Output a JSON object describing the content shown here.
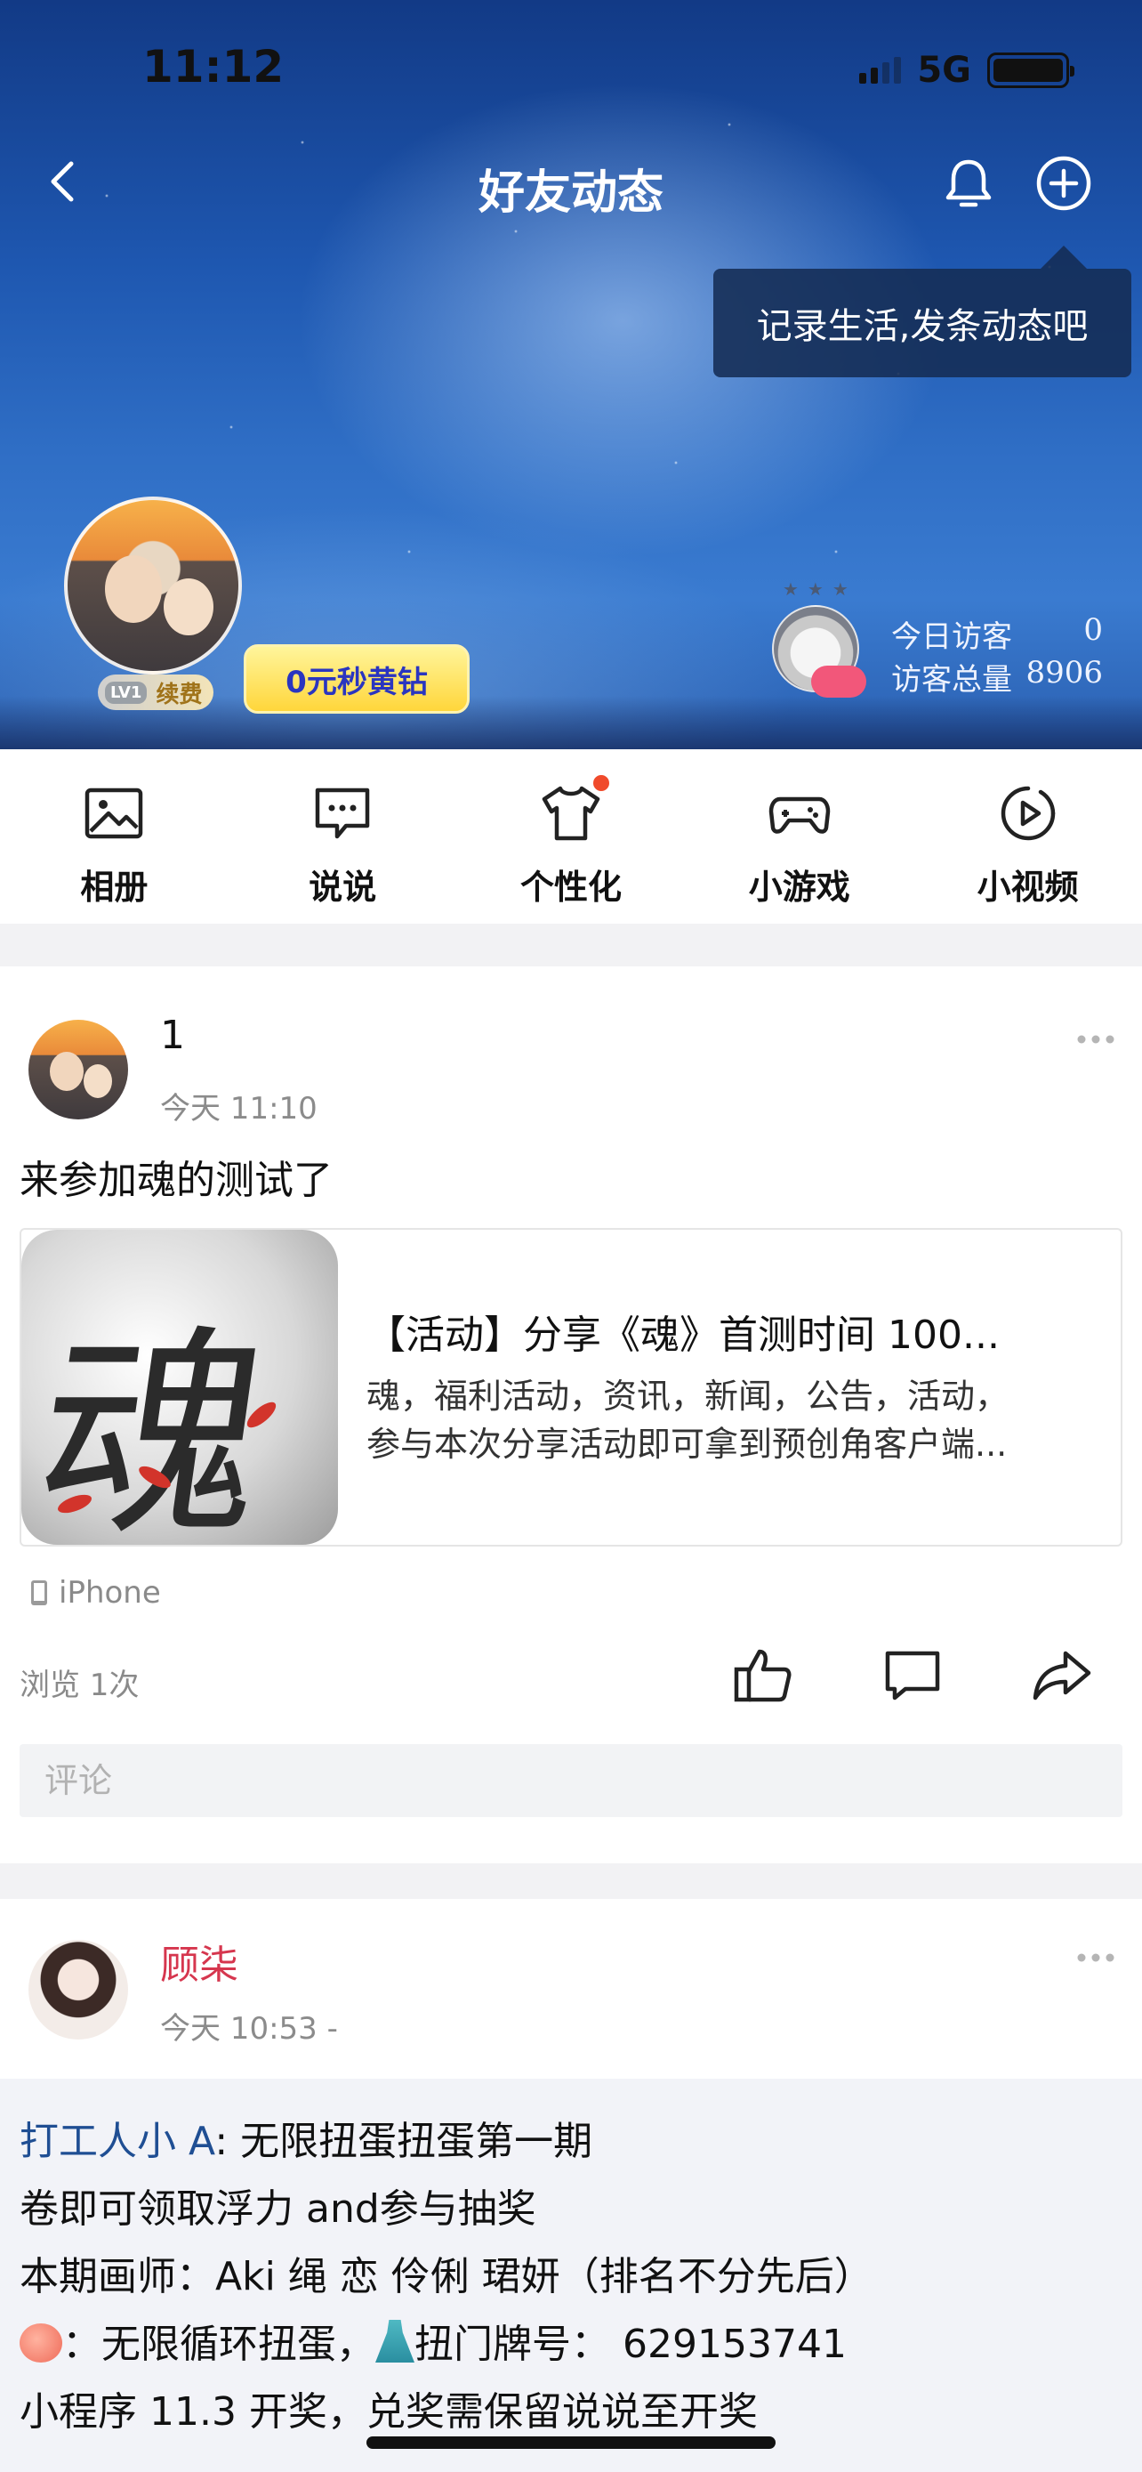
{
  "status_bar": {
    "time": "11:12",
    "network": "5G",
    "battery_level": 1.0
  },
  "nav": {
    "title": "好友动态"
  },
  "tooltip": {
    "text": "记录生活,发条动态吧"
  },
  "profile": {
    "level_badge": "LV1",
    "renew_label": "续费",
    "promo_label": "0元秒黄钻"
  },
  "visitors": {
    "today_label": "今日访客",
    "today_value": "0",
    "total_label": "访客总量",
    "total_value": "8906"
  },
  "quick_menu": [
    {
      "label": "相册",
      "icon": "photo-album-icon"
    },
    {
      "label": "说说",
      "icon": "chat-bubble-icon"
    },
    {
      "label": "个性化",
      "icon": "tshirt-icon"
    },
    {
      "label": "小游戏",
      "icon": "gamepad-icon"
    },
    {
      "label": "小视频",
      "icon": "play-circle-icon"
    }
  ],
  "post1": {
    "author": "1",
    "time": "今天 11:10",
    "text": "来参加魂的测试了",
    "share": {
      "thumb_glyph": "魂",
      "title": "【活动】分享《魂》首测时间 100...",
      "desc_line1": "魂，福利活动，资讯，新闻，公告，活动，",
      "desc_line2": "参与本次分享活动即可拿到预创角客户端..."
    },
    "device": "iPhone",
    "views": "浏览 1次",
    "comment_placeholder": "评论"
  },
  "post2": {
    "author": "顾柒",
    "time": "今天 10:53  -",
    "repost": {
      "original_author": "打工人小 A",
      "line1_rest": ": 无限扭蛋扭蛋第一期",
      "line2": "卷即可领取浮力 and参与抽奖",
      "line3": "本期画师：Aki 绳 恋 伶俐 珺妍（排名不分先后）",
      "line4_a": "：无限循环扭蛋，",
      "line4_b": "扭门牌号：  629153741",
      "line5": "小程序 11.3 开奖，兑奖需保留说说至开奖"
    }
  },
  "colors": {
    "accent_red": "#d6364e",
    "link_blue": "#1f4e93",
    "hero_blue": "#2f6ec5"
  }
}
